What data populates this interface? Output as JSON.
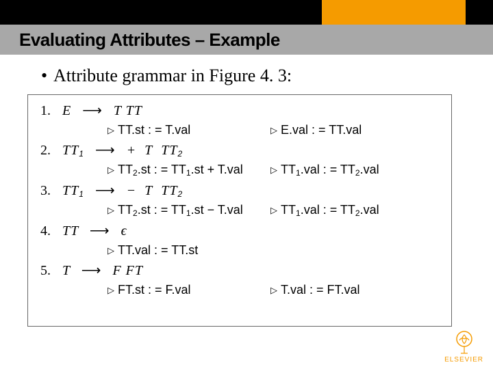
{
  "header": {
    "title": "Evaluating Attributes – Example"
  },
  "bullet": {
    "text": "Attribute grammar in Figure 4. 3:"
  },
  "grammar": {
    "rules": [
      {
        "num": "1.",
        "lhs": "E",
        "rhs": "T  TT",
        "attrs": [
          {
            "left": "TT.st : = T.val",
            "right": "E.val : = TT.val"
          }
        ]
      },
      {
        "num": "2.",
        "lhs": "TT₁",
        "rhs": "+  T  TT₂",
        "attrs": [
          {
            "left": "TT₂.st : = TT₁.st + T.val",
            "right": "TT₁.val : = TT₂.val"
          }
        ]
      },
      {
        "num": "3.",
        "lhs": "TT₁",
        "rhs": "−  T  TT₂",
        "attrs": [
          {
            "left": "TT₂.st : = TT₁.st − T.val",
            "right": "TT₁.val : = TT₂.val"
          }
        ]
      },
      {
        "num": "4.",
        "lhs": "TT",
        "rhs": "ϵ",
        "attrs": [
          {
            "left": "TT.val : = TT.st",
            "right": ""
          }
        ]
      },
      {
        "num": "5.",
        "lhs": "T",
        "rhs": "F  FT",
        "attrs": [
          {
            "left": "FT.st : = F.val",
            "right": "T.val : = FT.val"
          }
        ]
      }
    ]
  },
  "logo": {
    "text": "ELSEVIER"
  }
}
